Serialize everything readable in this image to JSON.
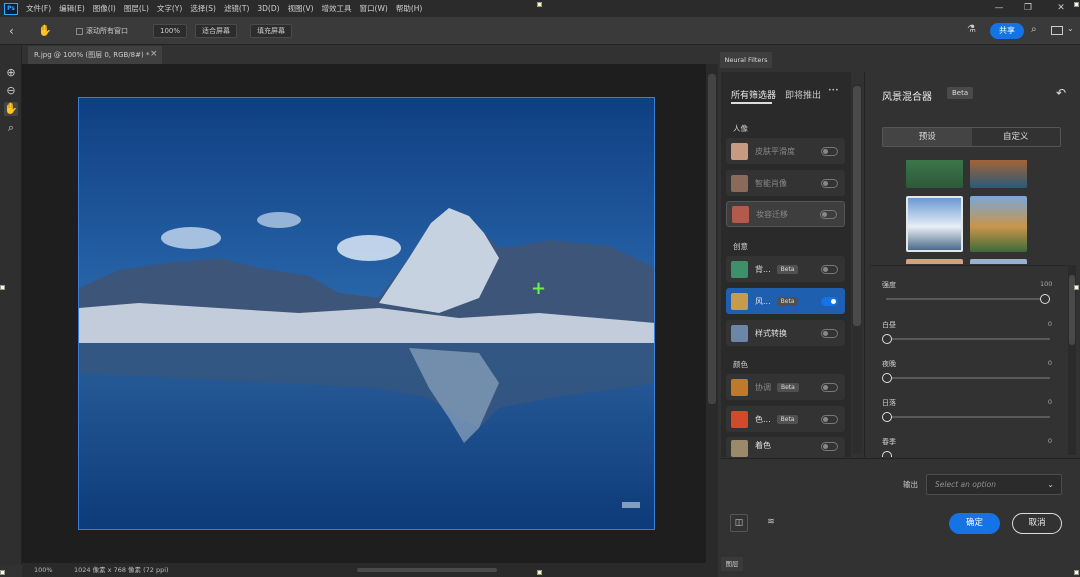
{
  "app": {
    "logo": "Ps"
  },
  "menu": [
    "文件(F)",
    "编辑(E)",
    "图像(I)",
    "图层(L)",
    "文字(Y)",
    "选择(S)",
    "滤镜(T)",
    "3D(D)",
    "视图(V)",
    "增效工具",
    "窗口(W)",
    "帮助(H)"
  ],
  "watermark": "公众号:参心笔记",
  "window_controls": {
    "minimize": "—",
    "restore": "❐",
    "close": "✕"
  },
  "options": {
    "scroll_all": "滚动所有窗口",
    "zoom": "100%",
    "fit_screen": "适合屏幕",
    "fill_screen": "填充屏幕",
    "share": "共享"
  },
  "document": {
    "tab_title": "R.jpg @ 100% (图层 0, RGB/8#) *",
    "close": "×"
  },
  "status": {
    "zoom": "100%",
    "info": "1024 像素 x 768 像素 (72 ppi)"
  },
  "neural_filters": {
    "tab": "Neural Filters",
    "list_tabs": [
      "所有筛选器",
      "即将推出"
    ],
    "sections": {
      "portrait": "人像",
      "creative": "创意",
      "color": "颜色"
    },
    "filters": [
      {
        "label": "皮肤平滑度",
        "enabled": false,
        "beta": false,
        "dim": true
      },
      {
        "label": "智能肖像",
        "enabled": false,
        "beta": false,
        "dim": true
      },
      {
        "label": "妆容迁移",
        "enabled": false,
        "beta": false,
        "dim": true
      },
      {
        "label": "背...",
        "enabled": false,
        "beta": true,
        "dim": false
      },
      {
        "label": "风...",
        "enabled": true,
        "beta": true,
        "dim": false
      },
      {
        "label": "样式转换",
        "enabled": false,
        "beta": false,
        "dim": false
      },
      {
        "label": "协调",
        "enabled": false,
        "beta": true,
        "dim": true
      },
      {
        "label": "色...",
        "enabled": false,
        "beta": true,
        "dim": false
      },
      {
        "label": "着色",
        "enabled": false,
        "beta": false,
        "dim": false
      }
    ],
    "beta_label": "Beta",
    "detail": {
      "title": "风景混合器",
      "beta": "Beta",
      "reset_icon": "↶",
      "segments": [
        "预设",
        "自定义"
      ],
      "sliders": [
        {
          "label": "强度",
          "value": "100",
          "pct": 100
        },
        {
          "label": "白昼",
          "value": "0",
          "pct": 0
        },
        {
          "label": "夜晚",
          "value": "0",
          "pct": 0
        },
        {
          "label": "日落",
          "value": "0",
          "pct": 0
        },
        {
          "label": "春季",
          "value": "0",
          "pct": 0
        }
      ],
      "output_label": "输出",
      "output_placeholder": "Select an option",
      "confirm": "确定",
      "cancel": "取消"
    }
  },
  "layers_tab": "图层",
  "colors": {
    "accent": "#1473e6",
    "watermark": "#2f8ff0"
  }
}
